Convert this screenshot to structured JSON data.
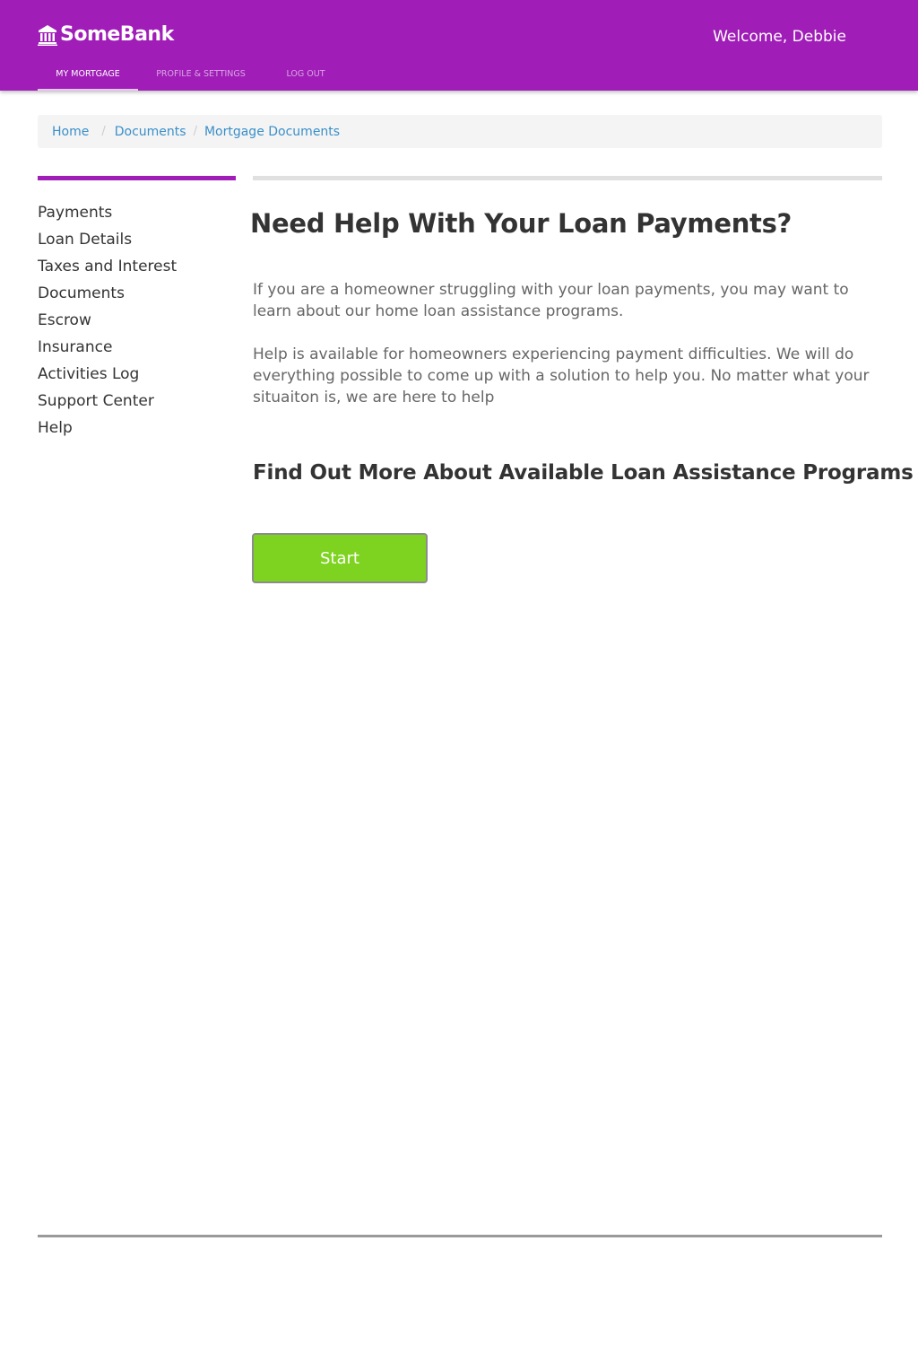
{
  "header": {
    "brand": "SomeBank",
    "welcome": "Welcome, Debbie",
    "nav": [
      {
        "label": "MY MORTGAGE",
        "active": true
      },
      {
        "label": "PROFILE & SETTINGS",
        "active": false
      },
      {
        "label": "LOG OUT",
        "active": false
      }
    ],
    "icon": "bank-building-icon"
  },
  "breadcrumb": {
    "items": [
      "Home",
      "Documents",
      "Mortgage Documents"
    ],
    "separator": "/"
  },
  "sidebar": {
    "items": [
      "Payments",
      "Loan Details",
      "Taxes and Interest",
      "Documents",
      "Escrow",
      "Insurance",
      "Activities Log",
      "Support Center",
      "Help"
    ]
  },
  "main": {
    "heading": "Need Help With Your Loan Payments?",
    "paragraph1": "If you are a homeowner struggling with your loan payments, you may want to learn about our home loan assistance programs.",
    "paragraph2": "Help is available for homeowners experiencing payment difficulties. We will do everything possible to come up with a solution to help you. No matter what your situaiton is, we are here to help",
    "subheading": "Find Out More About Available Loan Assistance Programs",
    "start_label": "Start"
  },
  "colors": {
    "brand": "#a01db8",
    "start_button": "#7ed321",
    "link": "#3a8fc9"
  }
}
